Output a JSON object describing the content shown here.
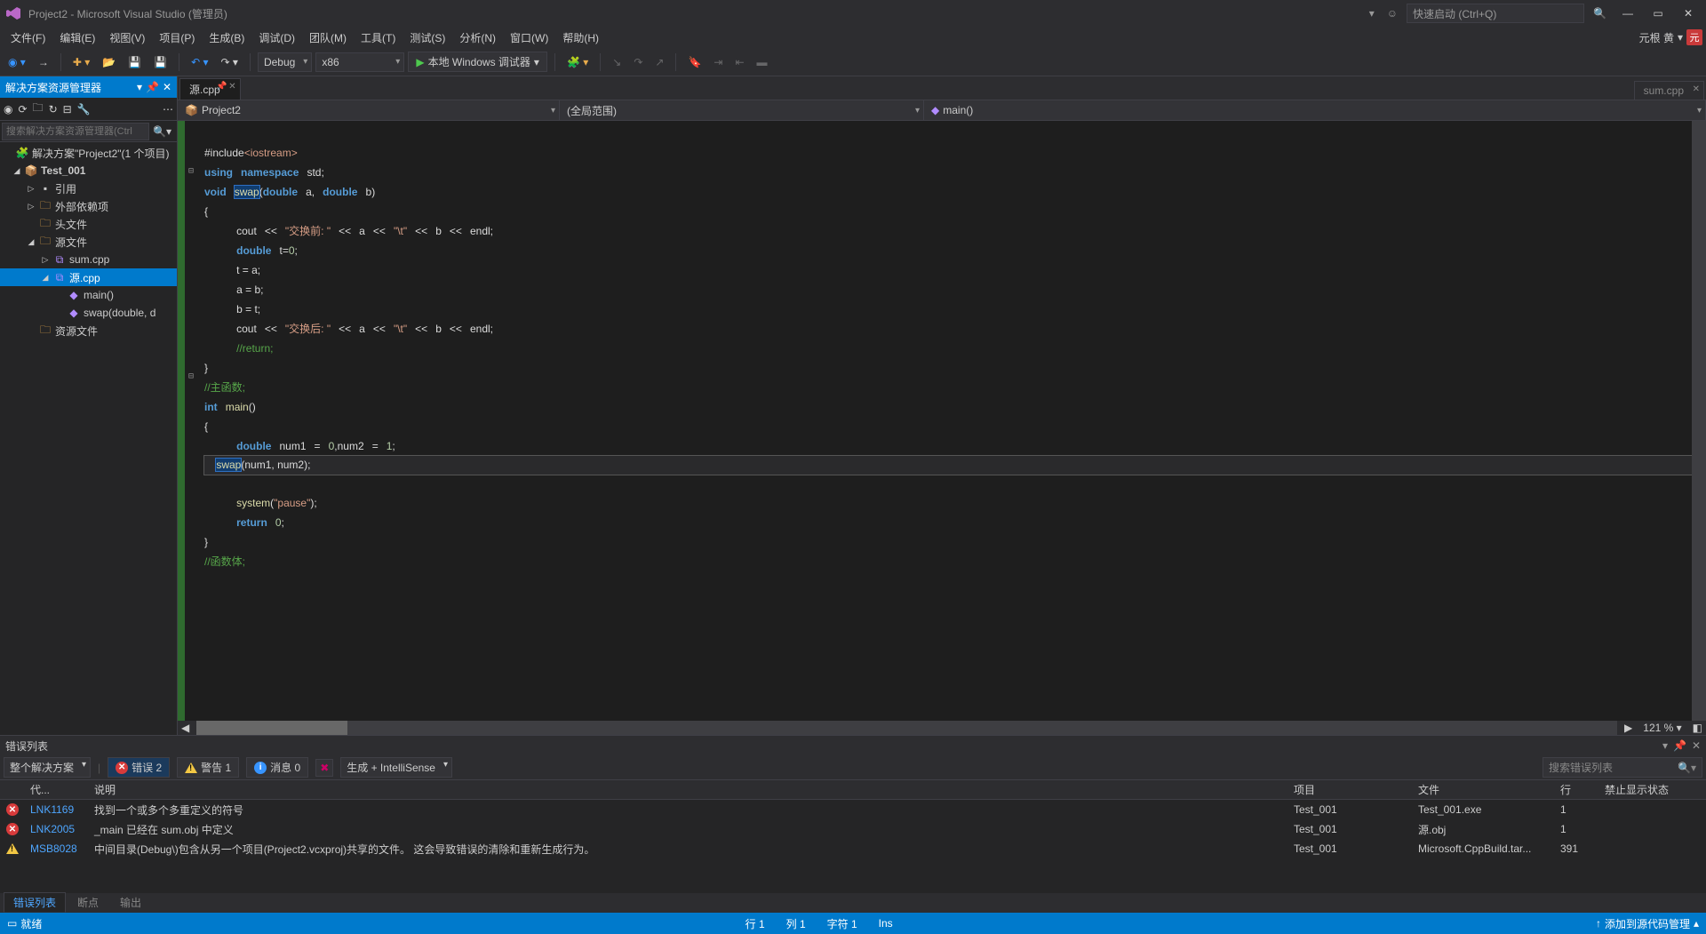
{
  "titlebar": {
    "title": "Project2 - Microsoft Visual Studio  (管理员)",
    "quick_launch_placeholder": "快速启动 (Ctrl+Q)"
  },
  "menubar": {
    "items": [
      "文件(F)",
      "编辑(E)",
      "视图(V)",
      "项目(P)",
      "生成(B)",
      "调试(D)",
      "团队(M)",
      "工具(T)",
      "测试(S)",
      "分析(N)",
      "窗口(W)",
      "帮助(H)"
    ],
    "user_name": "元根 黄",
    "user_initial": "元"
  },
  "toolbar": {
    "config": "Debug",
    "platform": "x86",
    "start_label": "本地 Windows 调试器"
  },
  "solution_explorer": {
    "title": "解决方案资源管理器",
    "search_placeholder": "搜索解决方案资源管理器(Ctrl",
    "solution": "解决方案\"Project2\"(1 个项目)",
    "project": "Test_001",
    "nodes": {
      "refs": "引用",
      "ext": "外部依赖项",
      "hdr": "头文件",
      "src": "源文件",
      "sum": "sum.cpp",
      "yuan": "源.cpp",
      "main": "main()",
      "swap": "swap(double, d",
      "res": "资源文件"
    }
  },
  "tabs": {
    "active": "源.cpp",
    "right": "sum.cpp"
  },
  "nav": {
    "scope1": "Project2",
    "scope2": "(全局范围)",
    "scope3": "main()"
  },
  "code": {
    "l1a": "#include",
    "l1b": "<iostream>",
    "l2a": "using",
    "l2b": "namespace",
    "l2c": "std",
    "l3a": "void",
    "l3b": "swap",
    "l3c": "double",
    "l3d": "a",
    "l3e": "double",
    "l3f": "b",
    "o_brace": "{",
    "c_brace": "}",
    "l5a": "cout",
    "l5b": "<<",
    "l5c": "\"交换前: \"",
    "l5d": "<<",
    "l5e": "a",
    "l5f": "<<",
    "l5g": "\"\\t\"",
    "l5h": "<<",
    "l5i": "b",
    "l5j": "<<",
    "l5k": "endl",
    "l6a": "double",
    "l6b": "t",
    "l6eq": "=",
    "l6z": "0",
    "l7": "t = a;",
    "l8": "a = b;",
    "l9": "b = t;",
    "l10a": "cout",
    "l10b": "<<",
    "l10c": "\"交换后: \"",
    "l10d": "<<",
    "l10e": "a",
    "l10f": "<<",
    "l10g": "\"\\t\"",
    "l10h": "<<",
    "l10i": "b",
    "l10j": "<<",
    "l10k": "endl",
    "l11": "//return;",
    "l13": "//主函数;",
    "l14a": "int",
    "l14b": "main",
    "l16a": "double",
    "l16b": "num1",
    "l16c": "0",
    "l16d": "num2",
    "l16e": "1",
    "l17a": "swap",
    "l17b": "num1",
    "l17c": "num2",
    "l18a": "system",
    "l18b": "\"pause\"",
    "l19a": "return",
    "l19b": "0",
    "l21": "//函数体;"
  },
  "zoom": "121 %",
  "error_list": {
    "title": "错误列表",
    "scope": "整个解决方案",
    "errors_label": "错误 2",
    "warnings_label": "警告 1",
    "messages_label": "消息 0",
    "build_filter": "生成 + IntelliSense",
    "search_placeholder": "搜索错误列表",
    "headers": {
      "code": "代...",
      "desc": "说明",
      "proj": "项目",
      "file": "文件",
      "line": "行",
      "sup": "禁止显示状态"
    },
    "rows": [
      {
        "icon": "e",
        "code": "LNK1169",
        "desc": "找到一个或多个多重定义的符号",
        "proj": "Test_001",
        "file": "Test_001.exe",
        "line": "1"
      },
      {
        "icon": "e",
        "code": "LNK2005",
        "desc": "_main 已经在 sum.obj 中定义",
        "proj": "Test_001",
        "file": "源.obj",
        "line": "1"
      },
      {
        "icon": "w",
        "code": "MSB8028",
        "desc": "中间目录(Debug\\)包含从另一个项目(Project2.vcxproj)共享的文件。    这会导致错误的清除和重新生成行为。",
        "proj": "Test_001",
        "file": "Microsoft.CppBuild.tar...",
        "line": "391"
      }
    ],
    "bottom_tabs": [
      "错误列表",
      "断点",
      "输出"
    ]
  },
  "statusbar": {
    "ready": "就绪",
    "line": "行 1",
    "col": "列 1",
    "char": "字符 1",
    "ins": "Ins",
    "scm": "添加到源代码管理"
  }
}
